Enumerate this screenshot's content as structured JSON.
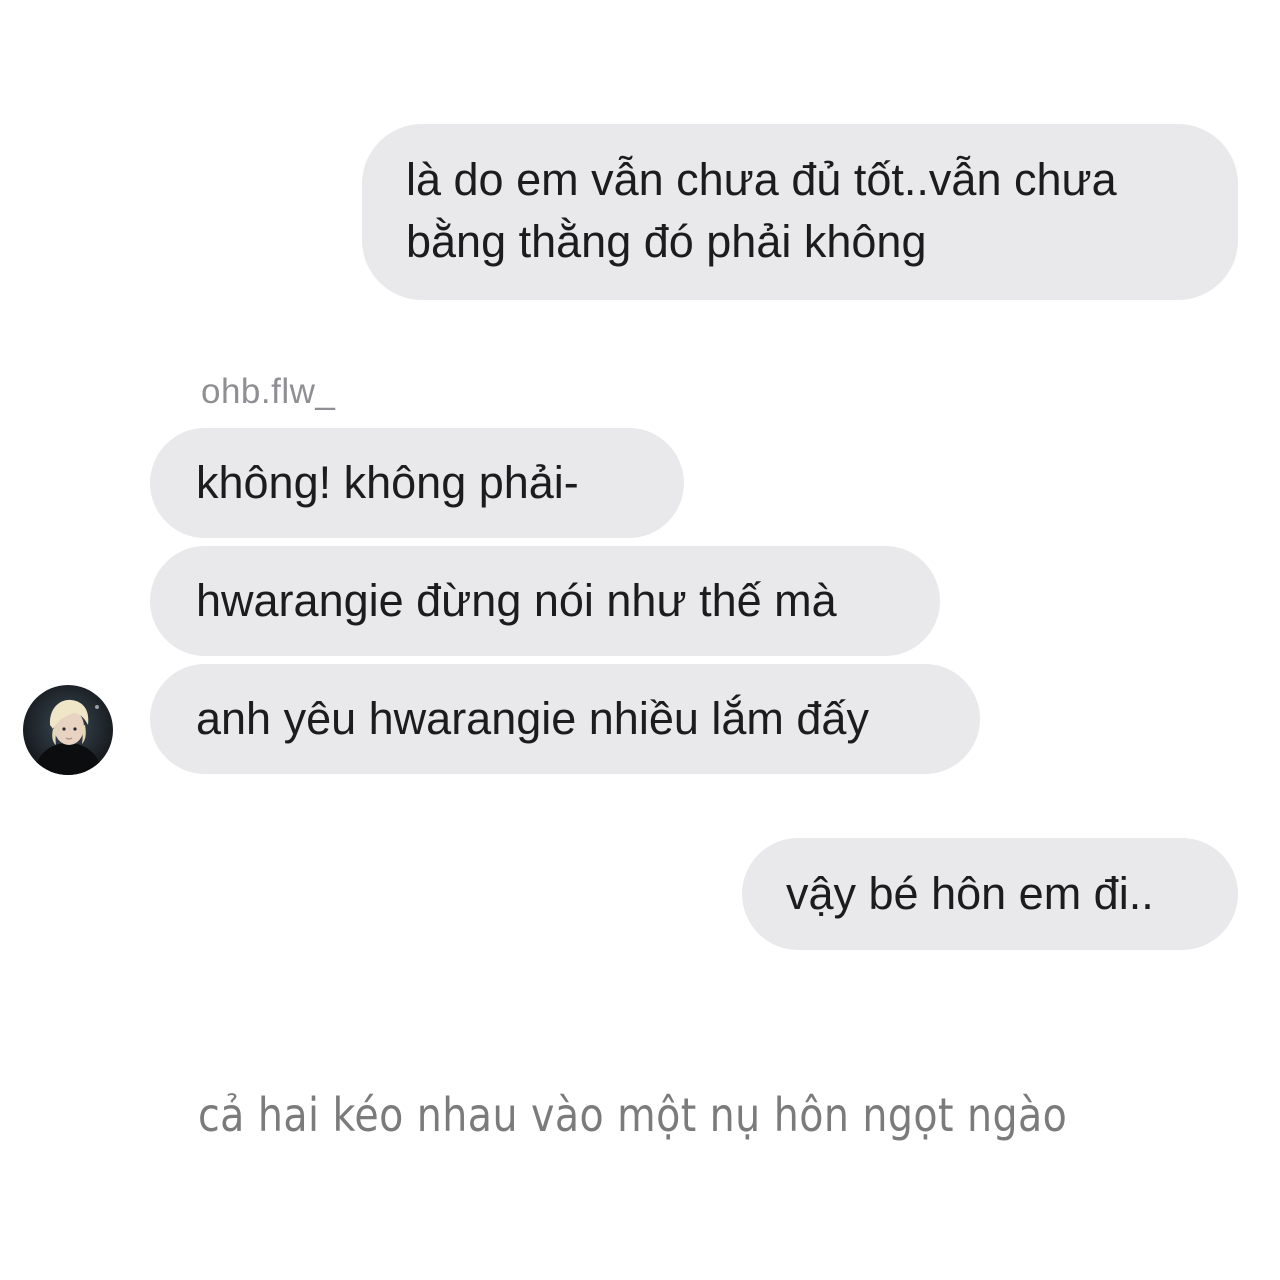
{
  "conversation": {
    "sent_messages": [
      {
        "lines": [
          "là do em vẫn chưa đủ tốt..vẫn chưa",
          "bằng thằng đó phải không"
        ]
      },
      {
        "lines": [
          "vậy bé hôn em đi.."
        ]
      }
    ],
    "received": {
      "sender_name": "ohb.flw_",
      "messages": [
        "không! không phải-",
        "hwarangie đừng nói như thế mà",
        "anh yêu hwarangie nhiều lắm đấy"
      ],
      "avatar_icon": "profile-avatar"
    }
  },
  "narration": "cả hai kéo nhau vào một nụ hôn ngọt ngào",
  "colors": {
    "bubble": "#e9e9eb",
    "message_text": "#1c1c1e",
    "sender_name": "#8e8e93",
    "narration": "#7b7b7b",
    "background": "#ffffff"
  }
}
